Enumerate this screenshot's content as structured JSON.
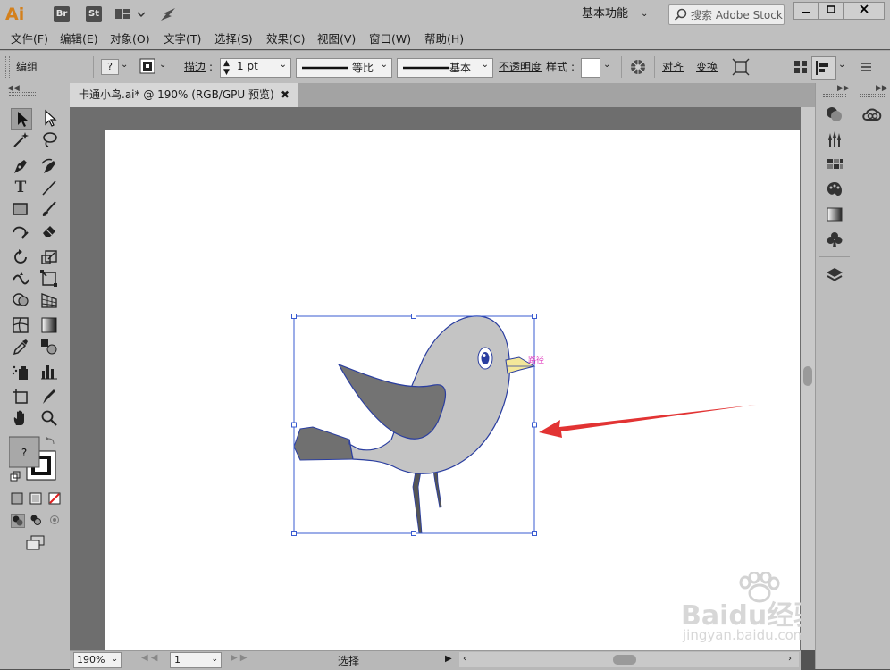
{
  "app": {
    "logo": "Ai",
    "bridge": "Br",
    "stock": "St",
    "workspace": "基本功能",
    "search_placeholder": "搜索 Adobe Stock"
  },
  "menu": [
    "文件(F)",
    "编辑(E)",
    "对象(O)",
    "文字(T)",
    "选择(S)",
    "效果(C)",
    "视图(V)",
    "窗口(W)",
    "帮助(H)"
  ],
  "control": {
    "group_label": "编组",
    "fill_value": "?",
    "stroke_label": "描边",
    "stroke_weight": "1 pt",
    "profile_label": "等比",
    "brush_label": "基本",
    "opacity_label": "不透明度",
    "style_label": "样式",
    "align_label": "对齐",
    "transform_label": "变换"
  },
  "document": {
    "tab_title": "卡通小鸟.ai* @ 190% (RGB/GPU 预览)",
    "path_hint": "路径"
  },
  "status": {
    "zoom": "190%",
    "artboard": "1",
    "tool": "选择"
  },
  "watermark": {
    "brand": "Baidu经验",
    "url": "jingyan.baidu.com"
  },
  "colors": {
    "accent": "#d4801b",
    "selection": "#3a5bd0",
    "path_hint": "#e040c0",
    "arrow": "#e23333"
  }
}
